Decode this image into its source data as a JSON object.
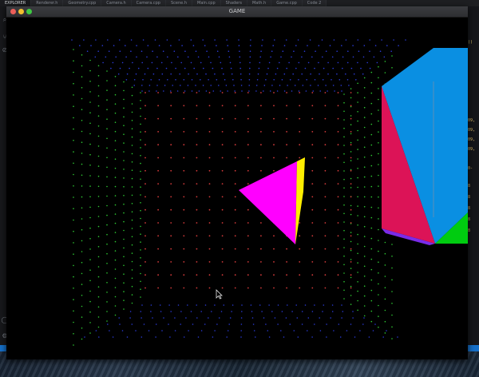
{
  "editor_tabs": [
    "EXPLORER",
    "Renderer.h",
    "Geometry.cpp",
    "Camera.h",
    "Camera.cpp",
    "Scene.h",
    "Main.cpp",
    "Shaders",
    "Math.h",
    "Game.cpp",
    "Code 2"
  ],
  "game_window": {
    "title": "GAME"
  },
  "scene": {
    "background": "#000000",
    "grid_colors": {
      "top": "#2b3bd6",
      "sides": "#2ec832",
      "back": "#d23a3a"
    },
    "shape_colors": {
      "triangle_main": "#ff00ff",
      "triangle_edge": "#ffee00",
      "prism_blue": "#0a8fe2",
      "prism_red": "#dc1357",
      "prism_green": "#00cc10",
      "prism_purple": "#7a2be8"
    }
  },
  "right_code_snippets": [
    "09,",
    "09,",
    "09,",
    "09,",
    "0-",
    "8",
    "8",
    "8",
    "8",
    "8"
  ]
}
